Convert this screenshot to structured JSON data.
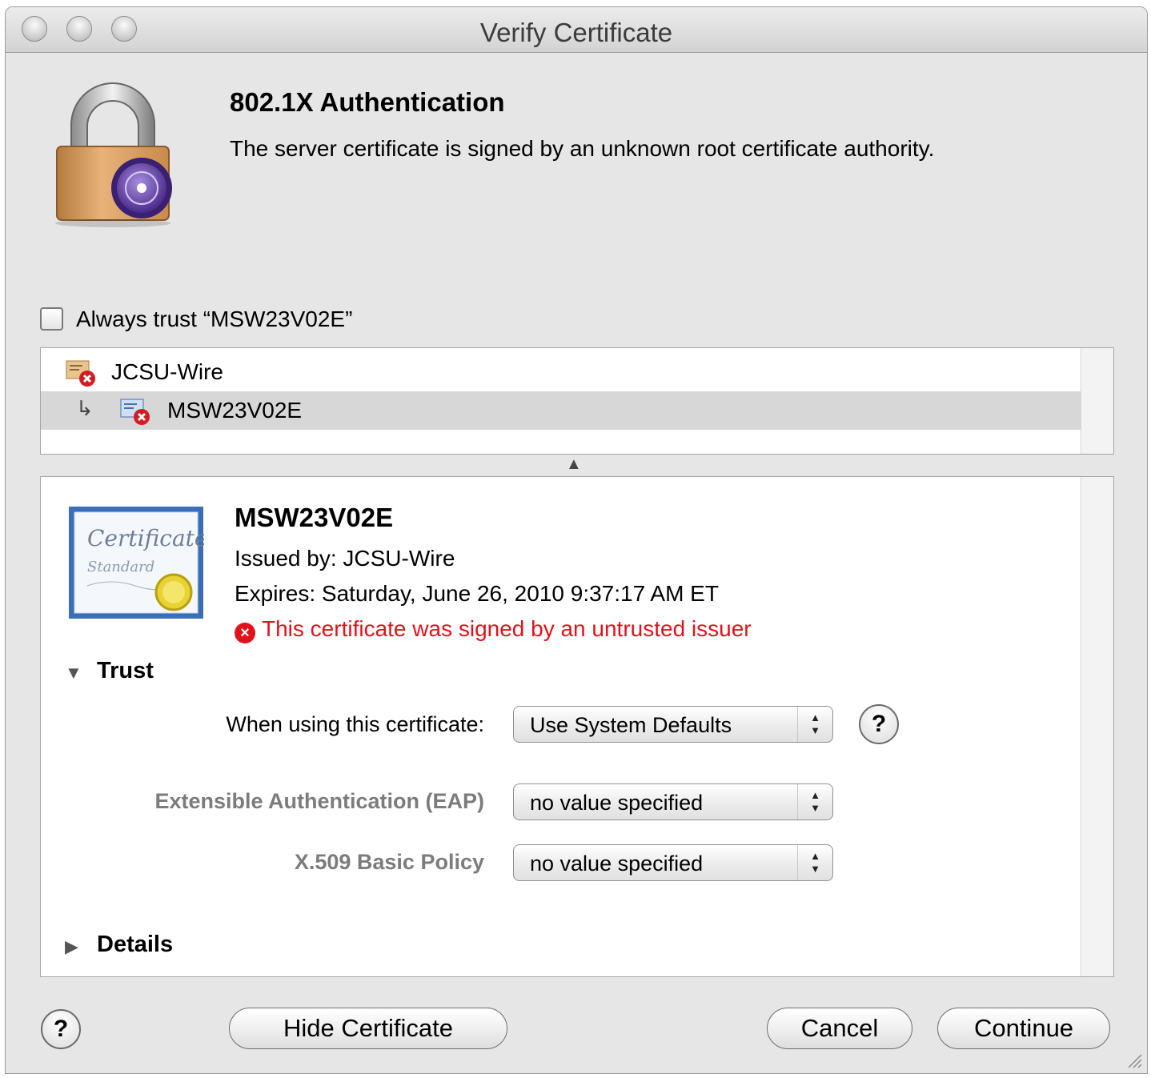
{
  "window": {
    "title": "Verify Certificate"
  },
  "header": {
    "title": "802.1X Authentication",
    "message": "The server certificate is signed by an unknown root certificate authority."
  },
  "always_trust": {
    "label": "Always trust “MSW23V02E”",
    "checked": false
  },
  "chain": [
    {
      "name": "JCSU-Wire",
      "selected": false
    },
    {
      "name": "MSW23V02E",
      "selected": true
    }
  ],
  "certificate": {
    "name": "MSW23V02E",
    "issued_by": "Issued by: JCSU-Wire",
    "expires": "Expires: Saturday, June 26, 2010 9:37:17 AM ET",
    "warning": "This certificate was signed by an untrusted issuer"
  },
  "trust": {
    "section_label": "Trust",
    "when_using_label": "When using this certificate:",
    "when_using_value": "Use System Defaults",
    "eap_label": "Extensible Authentication (EAP)",
    "eap_value": "no value specified",
    "x509_label": "X.509 Basic Policy",
    "x509_value": "no value specified"
  },
  "details": {
    "section_label": "Details"
  },
  "buttons": {
    "hide_certificate": "Hide Certificate",
    "cancel": "Cancel",
    "continue": "Continue",
    "help": "?"
  },
  "colors": {
    "warning": "#e0121b",
    "selection": "#d7d7d7"
  }
}
